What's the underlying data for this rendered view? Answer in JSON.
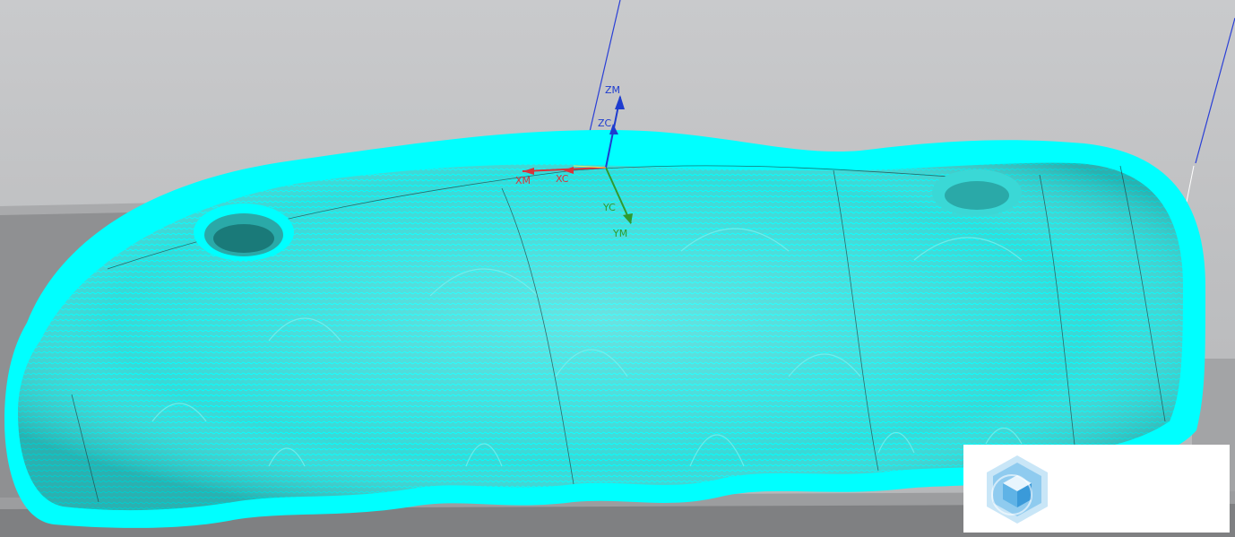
{
  "viewport": {
    "axis_labels": {
      "zm": "ZM",
      "zc": "ZC",
      "xm": "XM",
      "xc": "XC",
      "yc": "YC",
      "ym": "YM"
    },
    "colors": {
      "toolpath": "#00ffff",
      "part_surface": "#4fd6d4",
      "fixture_block": "#8f9092",
      "x_axis": "#d8333a",
      "y_axis": "#2e9a2e",
      "z_axis": "#1e3ccf",
      "z_guide_line": "#2a3fd6",
      "background_top": "#c9cacc",
      "background_bottom": "#b5b6b8"
    },
    "icons": {
      "watermark_logo": "cube-logo-icon"
    }
  }
}
